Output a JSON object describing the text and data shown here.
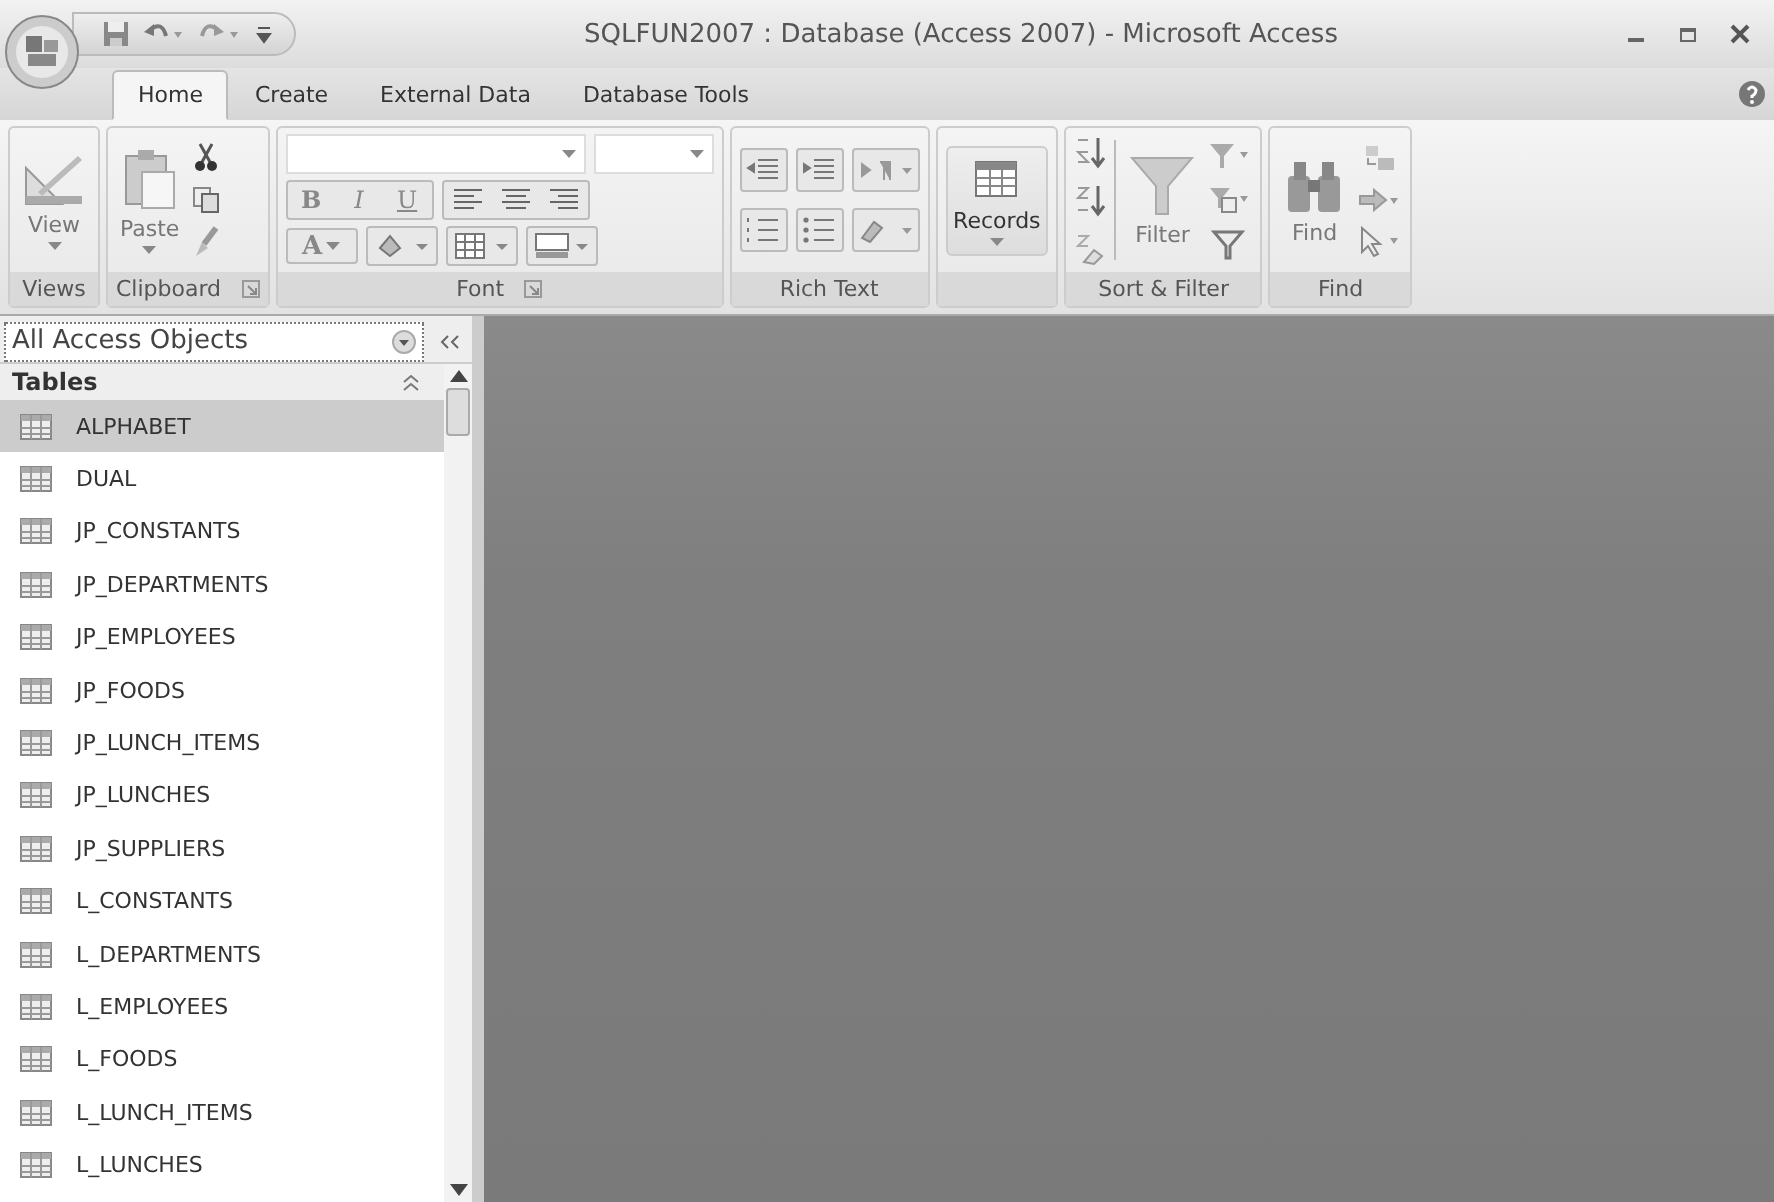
{
  "window": {
    "title": "SQLFUN2007 : Database (Access 2007) - Microsoft Access"
  },
  "tabs": [
    {
      "label": "Home",
      "selected": true
    },
    {
      "label": "Create",
      "selected": false
    },
    {
      "label": "External Data",
      "selected": false
    },
    {
      "label": "Database Tools",
      "selected": false
    }
  ],
  "ribbon_groups": [
    {
      "kind": "views",
      "label": "Views",
      "big_button": "View"
    },
    {
      "kind": "clipboard",
      "label": "Clipboard",
      "big_button": "Paste"
    },
    {
      "kind": "font",
      "label": "Font",
      "format_buttons": [
        "B",
        "I",
        "U"
      ],
      "font_color_button": "A"
    },
    {
      "kind": "richtext",
      "label": "Rich Text"
    },
    {
      "kind": "records",
      "big_button": "Records"
    },
    {
      "kind": "sortfilter",
      "label": "Sort & Filter",
      "big_button": "Filter"
    },
    {
      "kind": "find",
      "label": "Find",
      "big_button": "Find"
    }
  ],
  "nav_pane": {
    "header": "All Access Objects",
    "group": "Tables",
    "items": [
      {
        "label": "ALPHABET",
        "selected": true
      },
      {
        "label": "DUAL",
        "selected": false
      },
      {
        "label": "JP_CONSTANTS",
        "selected": false
      },
      {
        "label": "JP_DEPARTMENTS",
        "selected": false
      },
      {
        "label": "JP_EMPLOYEES",
        "selected": false
      },
      {
        "label": "JP_FOODS",
        "selected": false
      },
      {
        "label": "JP_LUNCH_ITEMS",
        "selected": false
      },
      {
        "label": "JP_LUNCHES",
        "selected": false
      },
      {
        "label": "JP_SUPPLIERS",
        "selected": false
      },
      {
        "label": "L_CONSTANTS",
        "selected": false
      },
      {
        "label": "L_DEPARTMENTS",
        "selected": false
      },
      {
        "label": "L_EMPLOYEES",
        "selected": false
      },
      {
        "label": "L_FOODS",
        "selected": false
      },
      {
        "label": "L_LUNCH_ITEMS",
        "selected": false
      },
      {
        "label": "L_LUNCHES",
        "selected": false
      }
    ]
  }
}
